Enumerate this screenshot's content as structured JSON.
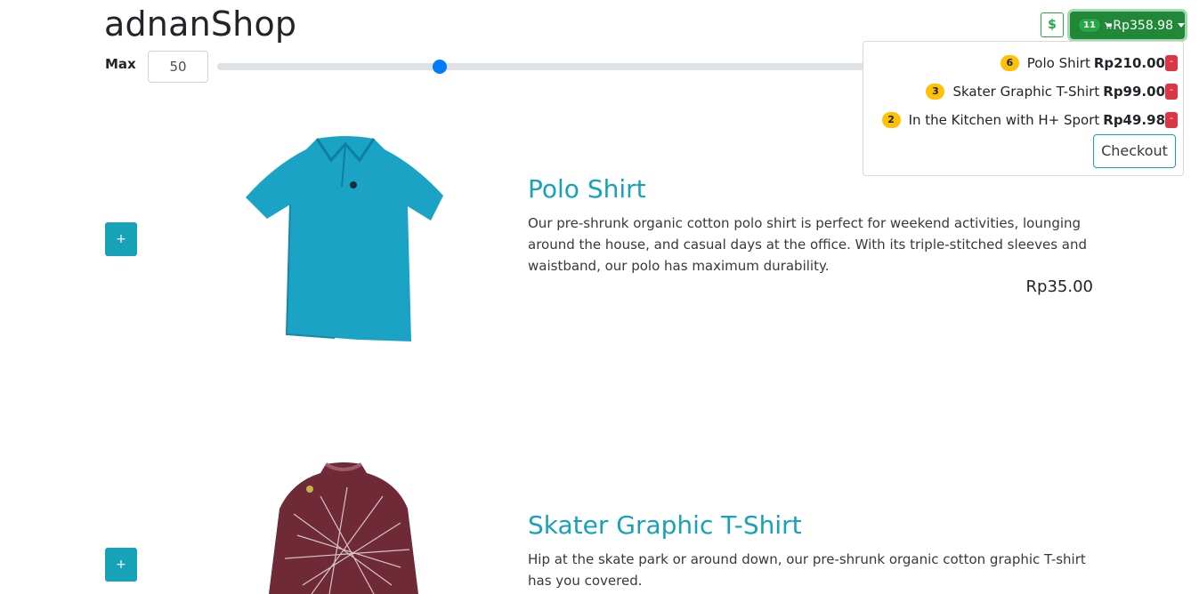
{
  "brand": "adnanShop",
  "filter": {
    "label": "Max",
    "value": "50",
    "slider_fraction": 0.33
  },
  "header": {
    "currency_button": "$",
    "cart_count": "11",
    "cart_total": "Rp358.98"
  },
  "cart_dropdown": {
    "items": [
      {
        "qty": "6",
        "name": "Polo Shirt",
        "price": "Rp210.00",
        "remove": "-"
      },
      {
        "qty": "3",
        "name": "Skater Graphic T-Shirt",
        "price": "Rp99.00",
        "remove": "-"
      },
      {
        "qty": "2",
        "name": "In the Kitchen with H+ Sport",
        "price": "Rp49.98",
        "remove": "-"
      }
    ],
    "checkout_label": "Checkout"
  },
  "products": [
    {
      "add_label": "+",
      "name": "Polo Shirt",
      "description": "Our pre-shrunk organic cotton polo shirt is perfect for weekend activities, lounging around the house, and casual days at the office. With its triple-stitched sleeves and waistband, our polo has maximum durability.",
      "price": "Rp35.00"
    },
    {
      "add_label": "+",
      "name": "Skater Graphic T-Shirt",
      "description": "Hip at the skate park or around down, our pre-shrunk organic cotton graphic T-shirt has you covered.",
      "price": ""
    }
  ],
  "colors": {
    "accent": "#17a2b8",
    "success": "#28a745",
    "warning": "#ffc107",
    "danger": "#dc3545",
    "slider": "#007bff"
  }
}
